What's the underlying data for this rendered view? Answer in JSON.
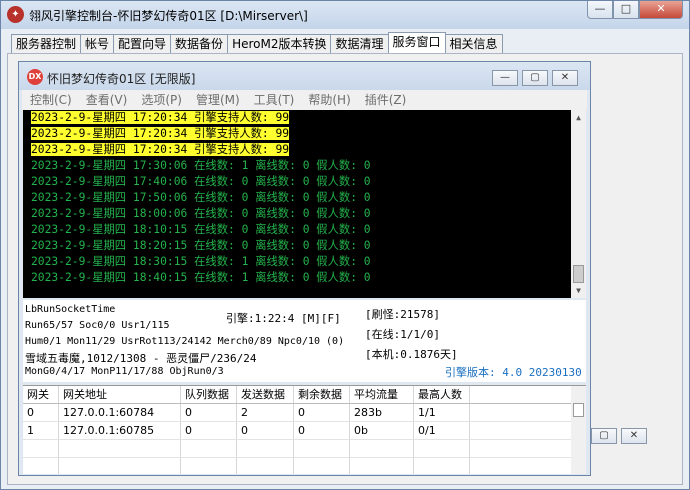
{
  "app": {
    "icon": "bird-logo-icon",
    "title": "翎风引擎控制台-怀旧梦幻传奇01区 [D:\\Mirserver\\]",
    "window_controls": [
      "—",
      "□",
      "✕"
    ]
  },
  "tabs": [
    {
      "label": "服务器控制",
      "active": false
    },
    {
      "label": "帐号",
      "active": false
    },
    {
      "label": "配置向导",
      "active": false
    },
    {
      "label": "数据备份",
      "active": false
    },
    {
      "label": "HeroM2版本转换",
      "active": false
    },
    {
      "label": "数据清理",
      "active": false
    },
    {
      "label": "服务窗口",
      "active": true
    },
    {
      "label": "相关信息",
      "active": false
    }
  ],
  "inner_window": {
    "icon_label": "DX",
    "title": "怀旧梦幻传奇01区 [无限版]",
    "controls": [
      "—",
      "▢",
      "✕"
    ],
    "menu": [
      "控制(C)",
      "查看(V)",
      "选项(P)",
      "管理(M)",
      "工具(T)",
      "帮助(H)",
      "插件(Z)"
    ]
  },
  "console_lines": [
    {
      "text": "2023-2-9-星期四 17:20:34 引擎支持人数: 99",
      "highlight": true
    },
    {
      "text": "2023-2-9-星期四 17:20:34 引擎支持人数: 99",
      "highlight": true
    },
    {
      "text": "2023-2-9-星期四 17:20:34 引擎支持人数: 99",
      "highlight": true
    },
    {
      "text": "2023-2-9-星期四 17:30:06 在线数: 1 离线数: 0 假人数: 0",
      "highlight": false
    },
    {
      "text": "2023-2-9-星期四 17:40:06 在线数: 0 离线数: 0 假人数: 0",
      "highlight": false
    },
    {
      "text": "2023-2-9-星期四 17:50:06 在线数: 0 离线数: 0 假人数: 0",
      "highlight": false
    },
    {
      "text": "2023-2-9-星期四 18:00:06 在线数: 0 离线数: 0 假人数: 0",
      "highlight": false
    },
    {
      "text": "2023-2-9-星期四 18:10:15 在线数: 0 离线数: 0 假人数: 0",
      "highlight": false
    },
    {
      "text": "2023-2-9-星期四 18:20:15 在线数: 0 离线数: 0 假人数: 0",
      "highlight": false
    },
    {
      "text": "2023-2-9-星期四 18:30:15 在线数: 1 离线数: 0 假人数: 0",
      "highlight": false
    },
    {
      "text": "2023-2-9-星期四 18:40:15 在线数: 1 离线数: 0 假人数: 0",
      "highlight": false
    }
  ],
  "status": {
    "socket": "LbRunSocketTime",
    "run": "Run65/57 Soc0/0 Usr1/115",
    "hum": "Hum0/1 Mon11/29 UsrRot113/24142 Merch0/89 Npc0/10 (0)",
    "monster": "雪域五毒魔,1012/1308 - 恶灵僵尸/236/24",
    "mon_go": "MonG0/4/17 MonP11/17/88 ObjRun0/3",
    "engine_time": "引擎:1:22:4 [M][F]",
    "refresh": "[刷怪:21578]",
    "online": "[在线:1/1/0]",
    "machine": "[本机:0.1876天]",
    "version": "引擎版本: 4.0 20230130"
  },
  "gateway_table": {
    "headers": [
      "网关",
      "网关地址",
      "队列数据",
      "发送数据",
      "剩余数据",
      "平均流量",
      "最高人数"
    ],
    "rows": [
      [
        "0",
        "127.0.0.1:60784",
        "0",
        "2",
        "0",
        "283b",
        "1/1"
      ],
      [
        "1",
        "127.0.0.1:60785",
        "0",
        "0",
        "0",
        "0b",
        "0/1"
      ]
    ]
  },
  "colors": {
    "console_bg": "#000000",
    "console_green": "#24b24b",
    "highlight_yellow": "#ffff30",
    "version_blue": "#1a6fc0"
  }
}
